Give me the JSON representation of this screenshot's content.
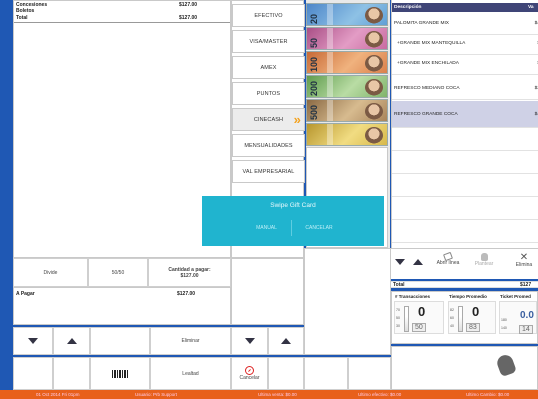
{
  "left_ticket": {
    "lines": [
      {
        "label": "Concesiones",
        "amount": "$127.00"
      },
      {
        "label": "Boletos",
        "amount": ""
      },
      {
        "label": "Total",
        "amount": "$127.00"
      }
    ],
    "divide_label": "Divide",
    "split_label": "50/50",
    "cantidad_label": "Cantidad a pagar:",
    "cantidad_value": "$127.00",
    "a_pagar_label": "A Pagar",
    "a_pagar_value": "$127.00"
  },
  "bottom_bar": {
    "eliminar_label": "Eliminar",
    "lealtad_label": "Lealtad",
    "cancelar_label": "Cancelar"
  },
  "payment_methods": [
    {
      "label": "EFECTIVO"
    },
    {
      "label": "VISA/MASTER"
    },
    {
      "label": "AMEX"
    },
    {
      "label": "PUNTOS"
    },
    {
      "label": "CINECASH"
    },
    {
      "label": "MENSUALIDADES"
    },
    {
      "label": "VAL EMPRESARIAL"
    }
  ],
  "bills": [
    {
      "amount": "20",
      "color": "#5f9fd6"
    },
    {
      "amount": "50",
      "color": "#c86aa0"
    },
    {
      "amount": "100",
      "color": "#d9804b"
    },
    {
      "amount": "200",
      "color": "#7fb36a"
    },
    {
      "amount": "500",
      "color": "#a9845a"
    },
    {
      "amount": "",
      "color": "#d7b84a"
    }
  ],
  "gift_card": {
    "title": "Swipe Gift Card",
    "manual_label": "MANUAL",
    "cancel_label": "CANCELAR",
    "color": "#20b4cf"
  },
  "order": {
    "header_desc": "Descripción",
    "header_val": "Va",
    "items": [
      {
        "desc": "PALOMITA GRANDE MIX",
        "val": "$4"
      },
      {
        "desc": "+GRANDE MIX MANTEQUILLA",
        "val": "$"
      },
      {
        "desc": "+GRANDE MIX ENCHILADA",
        "val": "$"
      },
      {
        "desc": "REFRESCO MEDIANO COCA",
        "val": "$3"
      },
      {
        "desc": "REFRESCO GRANDE COCA",
        "val": "$4"
      }
    ],
    "abrir_linea": "Abrir línea",
    "plantear": "Plantear",
    "eliminar": "Elimina",
    "total_label": "Total",
    "total_value": "$127"
  },
  "stats": {
    "transacciones_label": "# Transacciones",
    "tiempo_label": "Tiempo Promedio",
    "ticket_label": "Ticket Promed",
    "transacciones_value": "0",
    "transacciones_sub": "50",
    "tiempo_value": "0",
    "tiempo_sub": "83",
    "ticket_value": "0.0",
    "ticket_sub": "14",
    "ticks_a": [
      "70",
      "50",
      "30"
    ],
    "ticks_b": [
      "82",
      "60",
      "40"
    ],
    "ticks_c": [
      "180",
      "140"
    ]
  },
  "status_bar": {
    "segments": [
      "01 Oct 2014 Fri 01pm",
      "Usuario: Prb Support",
      "Ultima venta: $0.00",
      "Ultimo efectivo: $0.00",
      "Ultimo Cambio: $0.00"
    ],
    "color": "#e8601b"
  }
}
